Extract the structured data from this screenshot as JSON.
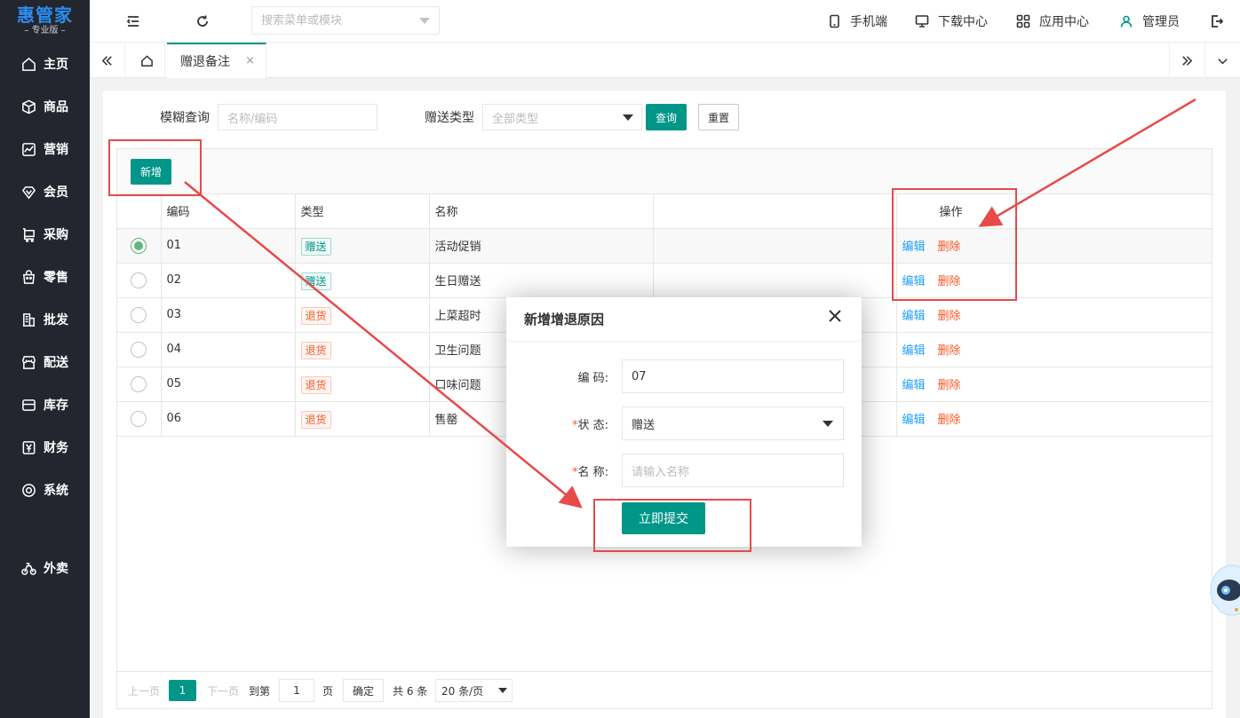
{
  "logo": {
    "title": "惠管家",
    "subtitle": "– 专业版 –"
  },
  "sidebar": {
    "items": [
      {
        "label": "主页",
        "icon": "home-icon"
      },
      {
        "label": "商品",
        "icon": "box-icon"
      },
      {
        "label": "营销",
        "icon": "chart-icon"
      },
      {
        "label": "会员",
        "icon": "diamond-icon"
      },
      {
        "label": "采购",
        "icon": "cart-icon"
      },
      {
        "label": "零售",
        "icon": "bag-icon"
      },
      {
        "label": "批发",
        "icon": "building-icon"
      },
      {
        "label": "配送",
        "icon": "store-icon"
      },
      {
        "label": "库存",
        "icon": "inbox-icon"
      },
      {
        "label": "财务",
        "icon": "yen-icon"
      },
      {
        "label": "系统",
        "icon": "settings-icon"
      },
      {
        "label": "外卖",
        "icon": "bike-icon"
      }
    ]
  },
  "header": {
    "search_placeholder": "搜索菜单或模块",
    "links": {
      "mobile": "手机端",
      "download": "下载中心",
      "apps": "应用中心",
      "user": "管理员"
    }
  },
  "tabs": {
    "active_label": "赠退备注",
    "close_glyph": "×"
  },
  "filters": {
    "fuzzy_label": "模糊查询",
    "fuzzy_placeholder": "名称/编码",
    "type_label": "赠送类型",
    "type_value": "全部类型",
    "query_button": "查询",
    "reset_button": "重置"
  },
  "toolbar": {
    "add_button": "新增"
  },
  "table": {
    "headers": {
      "code": "编码",
      "type": "类型",
      "name": "名称",
      "ops": "操作"
    },
    "edit_label": "编辑",
    "delete_label": "删除",
    "rows": [
      {
        "code": "01",
        "type": "赠送",
        "kind": "give",
        "name": "活动促销",
        "selected": true
      },
      {
        "code": "02",
        "type": "赠送",
        "kind": "give",
        "name": "生日赠送",
        "selected": false
      },
      {
        "code": "03",
        "type": "退货",
        "kind": "ret",
        "name": "上菜超时",
        "selected": false
      },
      {
        "code": "04",
        "type": "退货",
        "kind": "ret",
        "name": "卫生问题",
        "selected": false
      },
      {
        "code": "05",
        "type": "退货",
        "kind": "ret",
        "name": "口味问题",
        "selected": false
      },
      {
        "code": "06",
        "type": "退货",
        "kind": "ret",
        "name": "售罄",
        "selected": false
      }
    ]
  },
  "pager": {
    "prev": "上一页",
    "current": "1",
    "next": "下一页",
    "goto_label": "到第",
    "goto_value": "1",
    "page_unit": "页",
    "confirm": "确定",
    "total": "共 6 条",
    "page_size": "20 条/页"
  },
  "modal": {
    "title": "新增增退原因",
    "code_label": "编 码:",
    "code_value": "07",
    "status_label": "状 态:",
    "status_value": "赠送",
    "name_label": "名 称:",
    "name_placeholder": "请输入名称",
    "required_mark": "*",
    "submit": "立即提交"
  },
  "colors": {
    "sidebar_bg": "#23262e",
    "accent": "#009688",
    "logo_blue": "#2d8cf0",
    "annotation_red": "#e84a4a",
    "delete_red": "#ff5722",
    "edit_blue": "#1e9fff"
  }
}
